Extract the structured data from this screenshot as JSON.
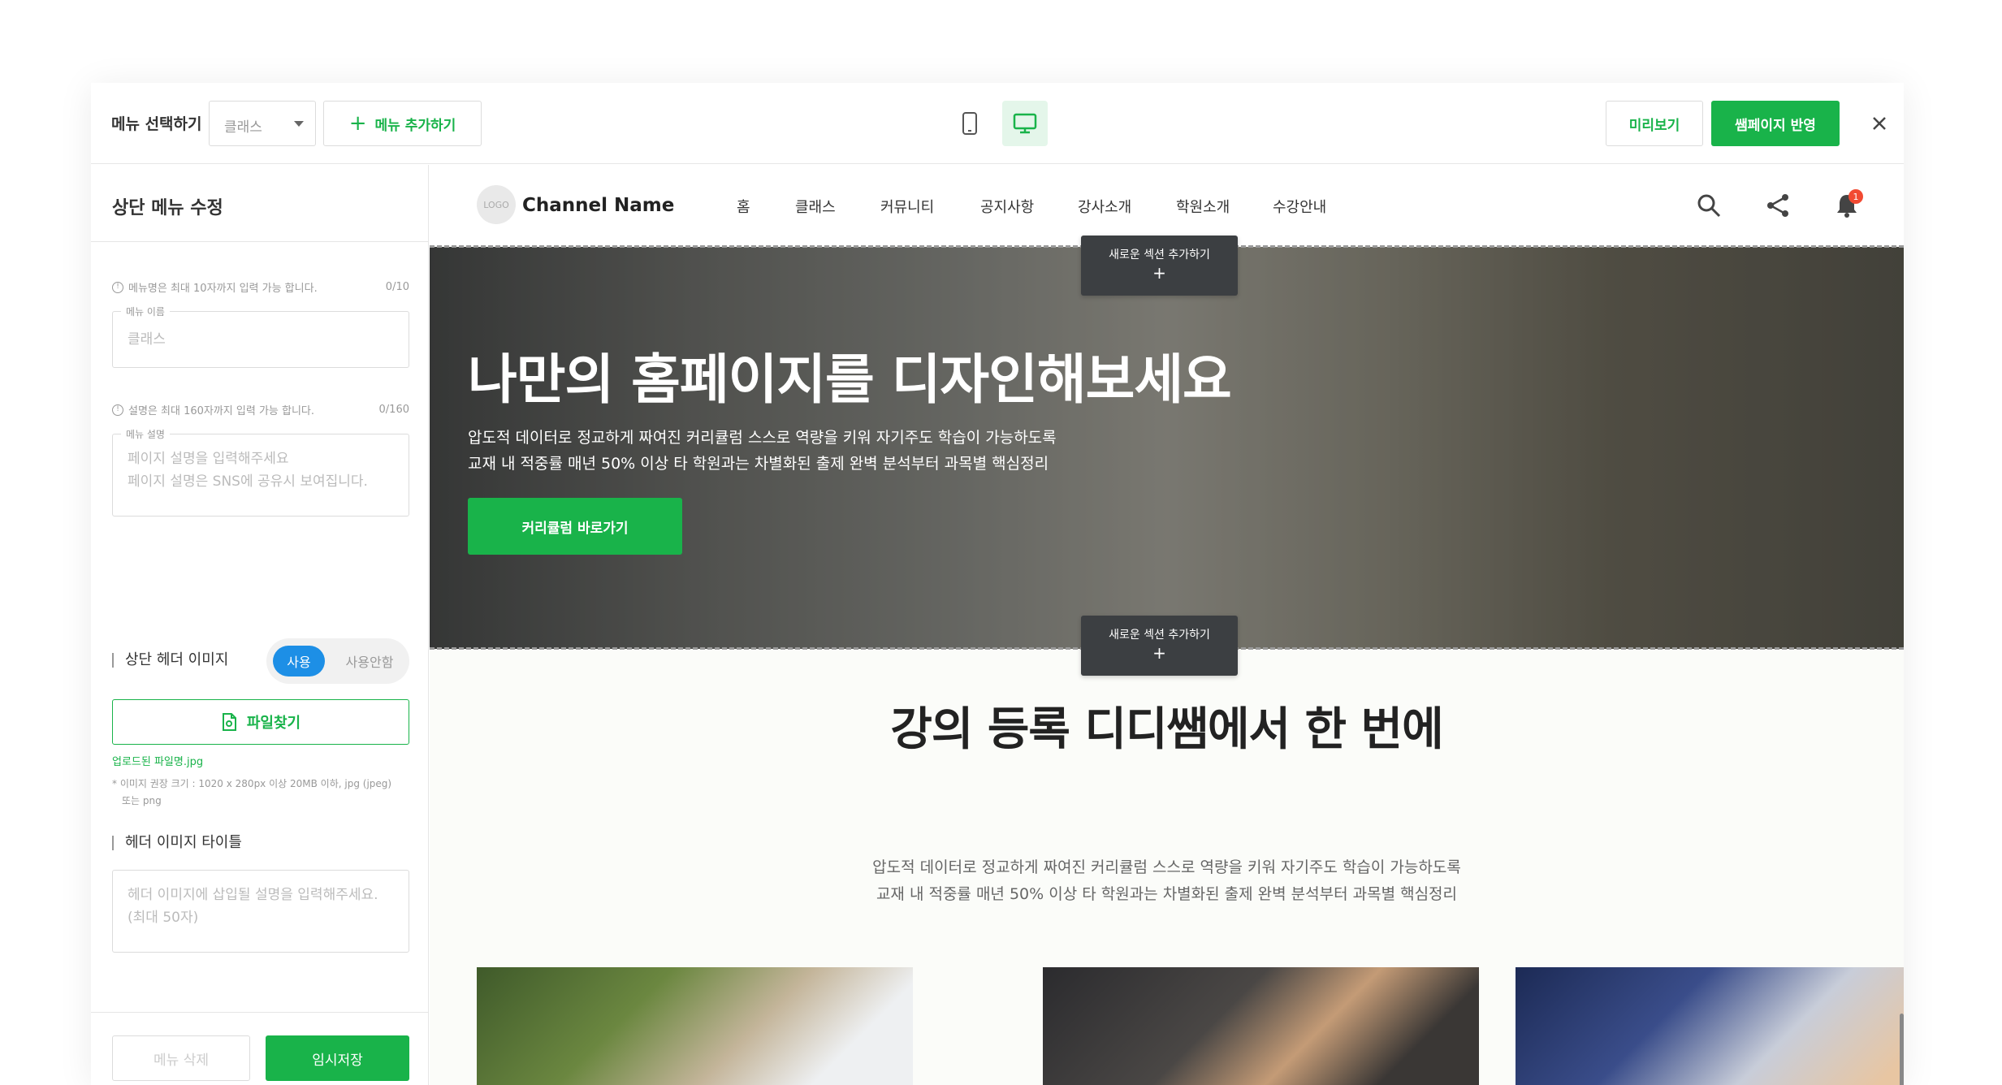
{
  "toolbar": {
    "menu_select_label": "메뉴 선택하기",
    "menu_select_value": "클래스",
    "add_menu_label": "메뉴 추가하기",
    "preview_label": "미리보기",
    "apply_label": "쌤페이지 반영"
  },
  "panel": {
    "title": "상단 메뉴 수정",
    "name_hint": "메뉴명은 최대 10자까지 입력 가능 합니다.",
    "name_count": "0/10",
    "name_legend": "메뉴 이름",
    "name_placeholder": "클래스",
    "desc_hint": "설명은 최대 160자까지 입력 가능 합니다.",
    "desc_count": "0/160",
    "desc_legend": "메뉴 설명",
    "desc_placeholder_1": "페이지 설명을 입력해주세요",
    "desc_placeholder_2": "페이지 설명은 SNS에 공유시 보여집니다.",
    "header_image_title": "상단 헤더 이미지",
    "toggle_on": "사용",
    "toggle_off": "사용안함",
    "file_button": "파일찾기",
    "uploaded_file": "업로드된 파일명.jpg",
    "spec_1": "* 이미지 권장 크기 : 1020 x 280px 이상 20MB 이하, jpg (jpeg)",
    "spec_2": "또는 png",
    "header_title_label": "헤더 이미지 타이틀",
    "header_title_placeholder_1": "헤더 이미지에 삽입될 설명을 입력해주세요.",
    "header_title_placeholder_2": "(최대 50자)",
    "delete_label": "메뉴 삭제",
    "save_label": "임시저장"
  },
  "site": {
    "logo_text": "LOGO",
    "channel_name": "Channel Name",
    "menu": [
      "홈",
      "클래스",
      "커뮤니티",
      "공지사항",
      "강사소개",
      "학원소개",
      "수강안내"
    ],
    "notification_count": "1",
    "add_section_label": "새로운 섹션 추가하기",
    "add_section_plus": "+",
    "hero": {
      "title": "나만의 홈페이지를 디자인해보세요",
      "line1": "압도적 데이터로 정교하게 짜여진 커리큘럼 스스로 역량을 키워 자기주도 학습이 가능하도록",
      "line2": "교재 내 적중률 매년 50% 이상 타 학원과는 차별화된 출제 완벽 분석부터 과목별 핵심정리",
      "cta": "커리큘럼 바로가기"
    },
    "section2": {
      "title": "강의 등록 디디쌤에서 한 번에",
      "line1": "압도적 데이터로 정교하게 짜여진 커리큘럼 스스로 역량을 키워 자기주도 학습이 가능하도록",
      "line2": "교재 내 적중률 매년 50% 이상 타 학원과는 차별화된 출제 완벽 분석부터 과목별 핵심정리"
    }
  },
  "colors": {
    "accent_green": "#19b34a",
    "toggle_blue": "#1d8fe6",
    "badge_red": "#f24a32"
  }
}
